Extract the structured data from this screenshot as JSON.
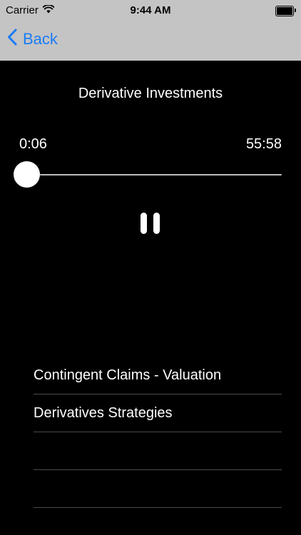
{
  "status_bar": {
    "carrier": "Carrier",
    "time": "9:44 AM",
    "wifi_icon": "wifi-icon",
    "battery_icon": "battery-icon"
  },
  "nav": {
    "back_label": "Back",
    "back_icon": "chevron-left-icon"
  },
  "player": {
    "title": "Derivative Investments",
    "elapsed": "0:06",
    "duration": "55:58",
    "progress": 0.0018,
    "pause_icon": "pause-icon"
  },
  "playlist": {
    "items": [
      {
        "label": "Contingent Claims - Valuation"
      },
      {
        "label": "Derivatives Strategies"
      },
      {
        "label": ""
      },
      {
        "label": ""
      }
    ]
  },
  "colors": {
    "background": "#000000",
    "bar_background": "#c4c4c4",
    "accent": "#1a7cf5",
    "text": "#ffffff",
    "separator": "#4a4a4a"
  }
}
